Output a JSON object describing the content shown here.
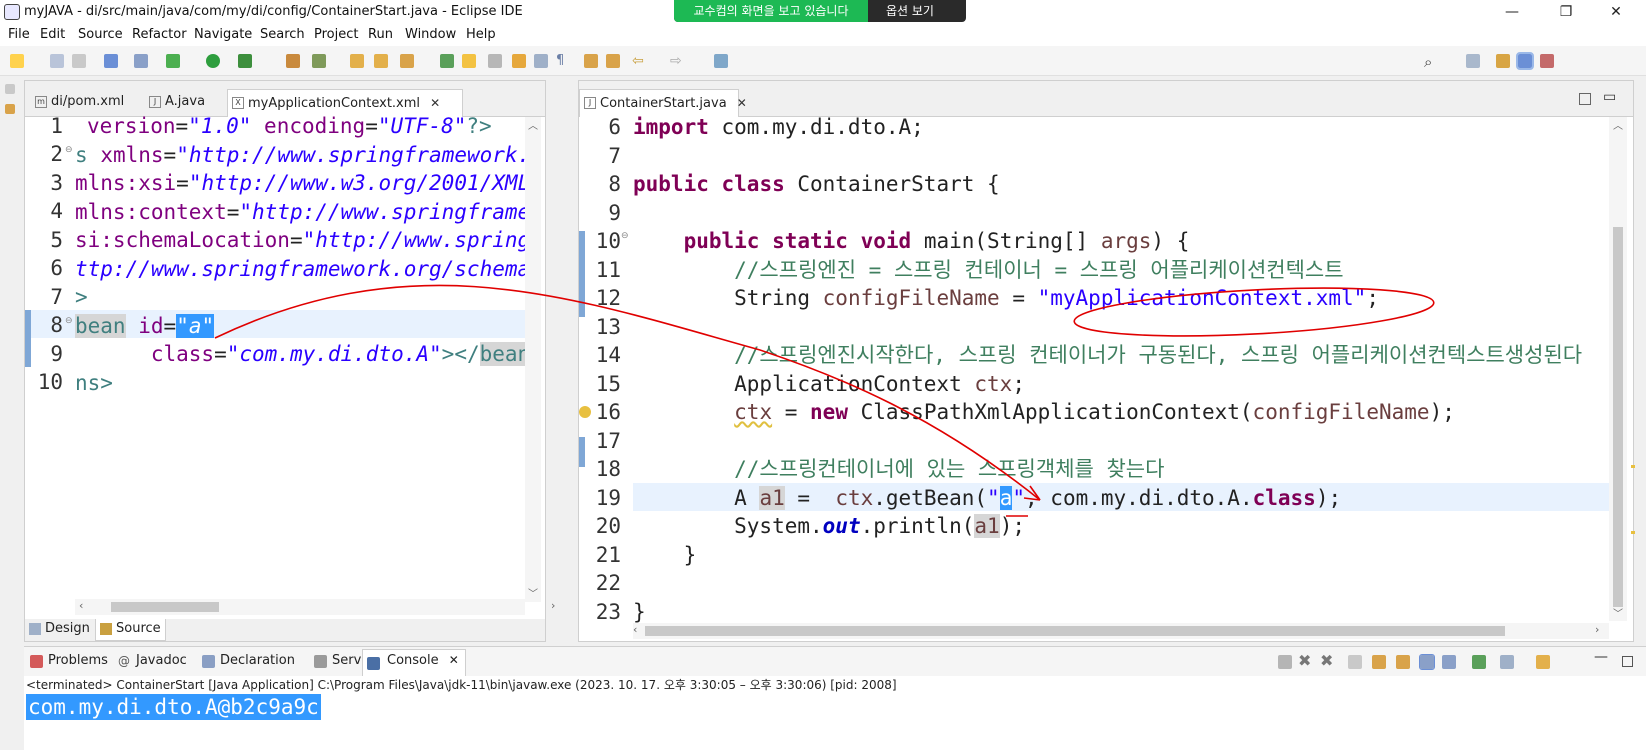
{
  "window": {
    "title": "myJAVA - di/src/main/java/com/my/di/config/ContainerStart.java - Eclipse IDE",
    "minimize": "—",
    "restore": "❐",
    "close": "✕"
  },
  "share_bar": {
    "message": "교수컴의 화면을 보고 있습니다",
    "options": "옵션 보기",
    "chevron": "⌄"
  },
  "menu": [
    "File",
    "Edit",
    "Source",
    "Refactor",
    "Navigate",
    "Search",
    "Project",
    "Run",
    "Window",
    "Help"
  ],
  "left_editor": {
    "tabs": [
      {
        "label": "di/pom.xml",
        "icon": "maven-icon"
      },
      {
        "label": "A.java",
        "icon": "java-file-icon"
      },
      {
        "label": "myApplicationContext.xml",
        "icon": "xml-file-icon",
        "active": true
      }
    ],
    "line_numbers": [
      "1",
      "2",
      "3",
      "4",
      "5",
      "6",
      "7",
      "8",
      "9",
      "10"
    ],
    "bottom_tabs": [
      "Design",
      "Source"
    ]
  },
  "right_editor": {
    "tabs": [
      {
        "label": "ContainerStart.java",
        "icon": "java-file-icon",
        "active": true
      }
    ],
    "line_numbers": [
      "6",
      "7",
      "8",
      "9",
      "10",
      "11",
      "12",
      "13",
      "14",
      "15",
      "16",
      "17",
      "18",
      "19",
      "20",
      "21",
      "22",
      "23"
    ]
  },
  "bottom_panel": {
    "tabs": [
      "Problems",
      "Javadoc",
      "Declaration",
      "Servers",
      "Console"
    ],
    "console_header": "<terminated> ContainerStart [Java Application] C:\\Program Files\\Java\\jdk-11\\bin\\javaw.exe  (2023. 10. 17. 오후 3:30:05 – 오후 3:30:06) [pid: 2008]",
    "console_output": "com.my.di.dto.A@b2c9a9c"
  },
  "colors": {
    "selection": "#3399ff",
    "keyword": "#7f0055",
    "string": "#2a00ff",
    "comment": "#3f7f5f",
    "annotation_pen": "#e00000",
    "share_green": "#1db954"
  }
}
